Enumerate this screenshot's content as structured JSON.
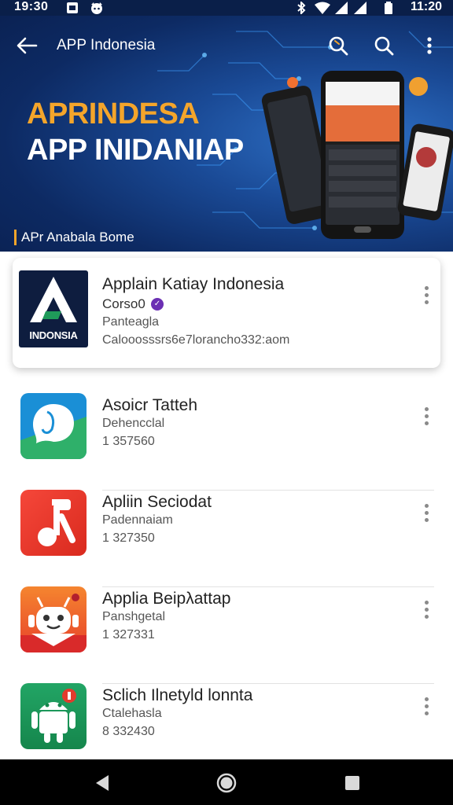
{
  "status_bar": {
    "time_left": "19:30",
    "time_right": "11:20"
  },
  "app_bar": {
    "title": "APP Indonesia"
  },
  "hero": {
    "headline_line1": "APRINDESA",
    "headline_line2": "APP INIDANIAP",
    "caption": "APr Anabala Bome"
  },
  "featured": {
    "logo_text": "INDONSIA",
    "title": "Applain Katiay Indonesia",
    "subtitle": "Corso0",
    "category": "Panteagla",
    "email": "Calooosssrs6e7lorancho332:aom"
  },
  "apps": [
    {
      "title": "Asoicr Tatteh",
      "subtitle": "Dehencclal",
      "number": "1 357560",
      "color": "#1a8fd6"
    },
    {
      "title": "Apliin Seciodat",
      "subtitle": "Padennaiam",
      "number": "1 327350",
      "color": "#ee3b2d"
    },
    {
      "title": "Applia Beipλattap",
      "subtitle": "Panshgetal",
      "number": "1 327331",
      "color": "#f06d2a"
    },
    {
      "title": "Sclich Ilnetyld lonnta",
      "subtitle": "Ctalehasla",
      "number": "8 332430",
      "color": "#1f9a5a"
    }
  ],
  "colors": {
    "accent_orange": "#f4a52b",
    "hero_dark": "#0d2a63",
    "badge_purple": "#6b2fb3"
  }
}
